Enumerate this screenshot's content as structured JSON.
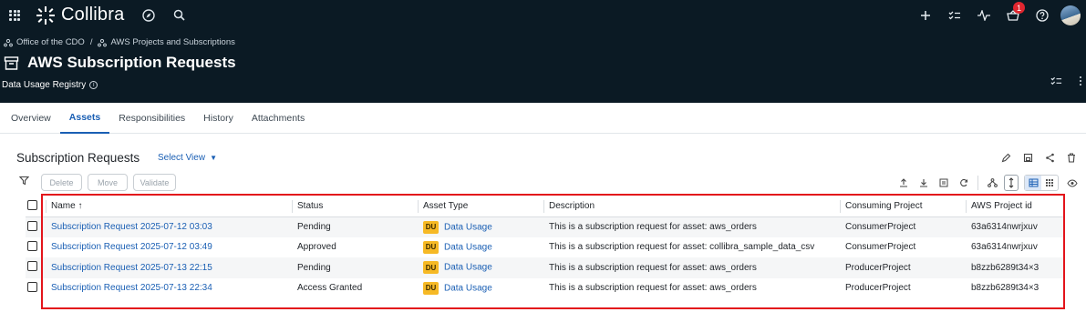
{
  "app": {
    "name": "Collibra",
    "notification_count": "1"
  },
  "breadcrumb": {
    "items": [
      "Office of the CDO",
      "AWS Projects and Subscriptions"
    ],
    "separator": "/"
  },
  "page": {
    "title": "AWS Subscription Requests",
    "subtitle": "Data Usage Registry",
    "info_glyph": "i"
  },
  "tabs": [
    "Overview",
    "Assets",
    "Responsibilities",
    "History",
    "Attachments"
  ],
  "active_tab": "Assets",
  "section": {
    "title": "Subscription Requests",
    "select_view": "Select View"
  },
  "toolbar": {
    "delete": "Delete",
    "move": "Move",
    "validate": "Validate"
  },
  "table": {
    "columns": [
      "Name ↑",
      "Status",
      "Asset Type",
      "Description",
      "Consuming Project",
      "AWS Project id"
    ],
    "rows": [
      {
        "name": "Subscription Request 2025-07-12 03:03",
        "status": "Pending",
        "type_badge": "DU",
        "type": "Data Usage",
        "description": "This is a subscription request for asset: aws_orders",
        "project": "ConsumerProject",
        "aws_id": "63a6314nwrjxuv"
      },
      {
        "name": "Subscription Request 2025-07-12 03:49",
        "status": "Approved",
        "type_badge": "DU",
        "type": "Data Usage",
        "description": "This is a subscription request for asset: collibra_sample_data_csv",
        "project": "ConsumerProject",
        "aws_id": "63a6314nwrjxuv"
      },
      {
        "name": "Subscription Request 2025-07-13 22:15",
        "status": "Pending",
        "type_badge": "DU",
        "type": "Data Usage",
        "description": "This is a subscription request for asset: aws_orders",
        "project": "ProducerProject",
        "aws_id": "b8zzb6289t34×3"
      },
      {
        "name": "Subscription Request 2025-07-13 22:34",
        "status": "Access Granted",
        "type_badge": "DU",
        "type": "Data Usage",
        "description": "This is a subscription request for asset: aws_orders",
        "project": "ProducerProject",
        "aws_id": "b8zzb6289t34×3"
      }
    ]
  },
  "colors": {
    "nav_bg": "#0b1a24",
    "link": "#1a5fb4",
    "badge_du": "#f6b925",
    "highlight_box": "#e3141b",
    "notification": "#e0262f"
  },
  "icons": [
    "apps-grid-icon",
    "collibra-logo-icon",
    "compass-icon",
    "search-icon",
    "plus-icon",
    "tasks-icon",
    "activity-icon",
    "basket-icon",
    "help-icon",
    "avatar",
    "community-icon",
    "domain-archive-icon",
    "info-icon",
    "more-vertical-icon",
    "edit-icon",
    "save-icon",
    "share-icon",
    "delete-icon",
    "filter-icon",
    "upload-icon",
    "download-icon",
    "export-icon",
    "refresh-icon",
    "hierarchy-icon",
    "row-height-icon",
    "table-view-icon",
    "grid-view-icon",
    "eye-icon"
  ]
}
